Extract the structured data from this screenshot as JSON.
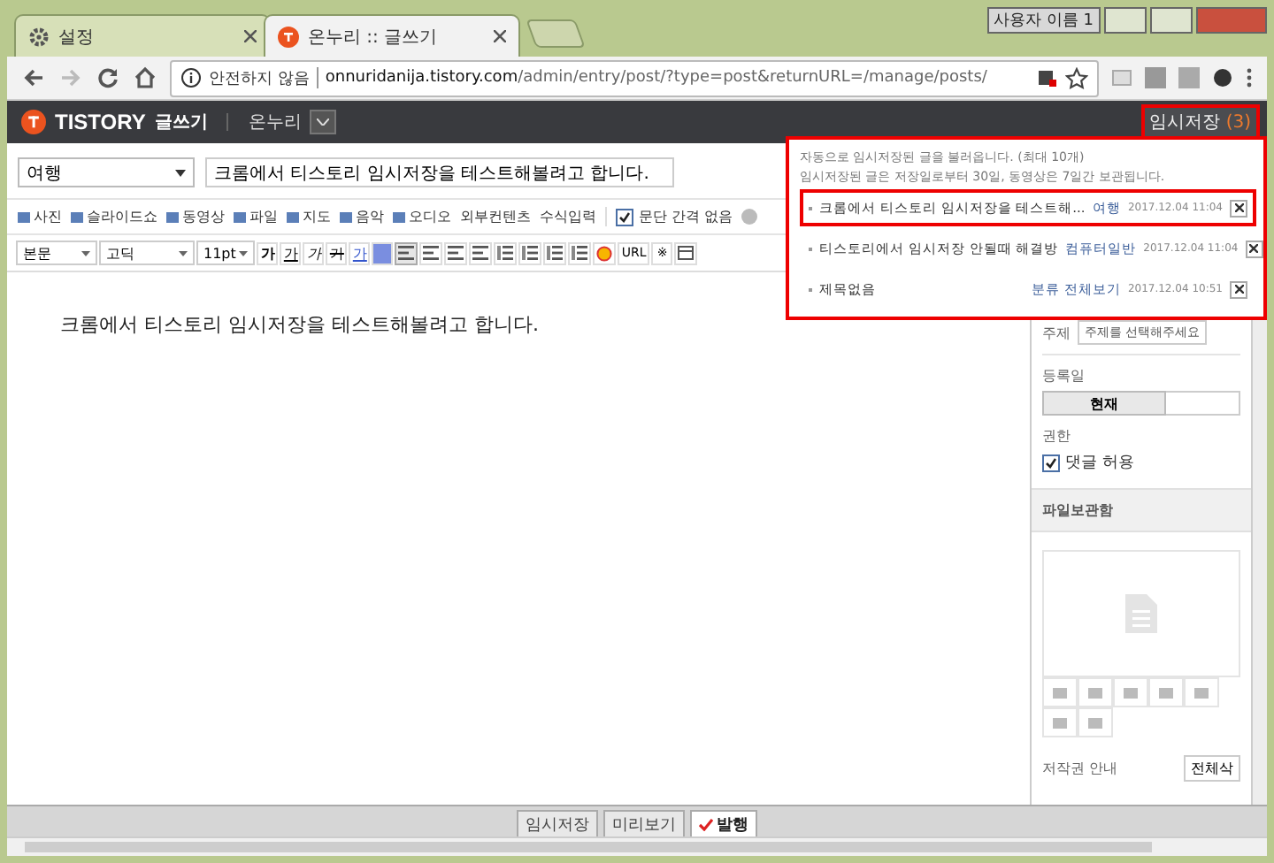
{
  "browser": {
    "tabs": [
      {
        "label": "설정",
        "kind": "settings",
        "selected": false
      },
      {
        "label": "온누리 :: 글쓰기",
        "kind": "site",
        "selected": true
      }
    ],
    "profile": "사용자 이름 1",
    "security": "안전하지 않음",
    "host": "onnuridanija.tistory.com",
    "path": "/admin/entry/post/?type=post&returnURL=/manage/posts/"
  },
  "header": {
    "logo": "TISTORY",
    "page": "글쓰기",
    "blog": "온누리",
    "draft_label": "임시저장",
    "draft_count": "(3)"
  },
  "editor": {
    "category": "여행",
    "title": "크롬에서 티스토리 임시저장을 테스트해볼려고 합니다.",
    "insert_tools": [
      "사진",
      "슬라이드쇼",
      "동영상",
      "파일",
      "지도",
      "음악",
      "오디오",
      "외부컨텐츠",
      "수식입력"
    ],
    "paragraph_spacing": {
      "label": "문단 간격 없음",
      "checked": true
    },
    "style": "본문",
    "font": "고딕",
    "size": "11pt",
    "format_buttons": [
      {
        "label": "가",
        "kind": "bold"
      },
      {
        "label": "가",
        "kind": "underline"
      },
      {
        "label": "가",
        "kind": "italic"
      },
      {
        "label": "가",
        "kind": "strike"
      },
      {
        "label": "가",
        "kind": "color"
      }
    ],
    "url_button": "URL",
    "mark_button": "※",
    "body": "크롬에서 티스토리 임시저장을 테스트해볼려고 합니다."
  },
  "drafts_popup": {
    "notice": [
      "자동으로 임시저장된 글을 불러옵니다. (최대 10개)",
      "임시저장된 글은 저장일로부터 30일, 동영상은 7일간 보관됩니다."
    ],
    "items": [
      {
        "title": "크롬에서 티스토리 임시저장을 테스트해...",
        "category": "여행",
        "date": "2017.12.04 11:04",
        "selected": true
      },
      {
        "title": "티스토리에서 임시저장 안될때 해결방",
        "category": "컴퓨터일반",
        "date": "2017.12.04 11:04",
        "selected": false
      },
      {
        "title": "제목없음",
        "category": "분류 전체보기",
        "date": "2017.12.04 10:51",
        "selected": false
      }
    ]
  },
  "sidebar": {
    "topic_label": "주제",
    "topic_placeholder": "주제를 선택해주세요",
    "date_label": "등록일",
    "date_option": "현재",
    "permission_label": "권한",
    "comment": {
      "label": "댓글 허용",
      "checked": true
    },
    "file_box_title": "파일보관함",
    "copyright_label": "저작권 안내",
    "copyright_button": "전체삭"
  },
  "bottom_buttons": [
    {
      "label": "임시저장",
      "kind": "plain"
    },
    {
      "label": "미리보기",
      "kind": "plain"
    },
    {
      "label": "발행",
      "kind": "publish"
    }
  ]
}
